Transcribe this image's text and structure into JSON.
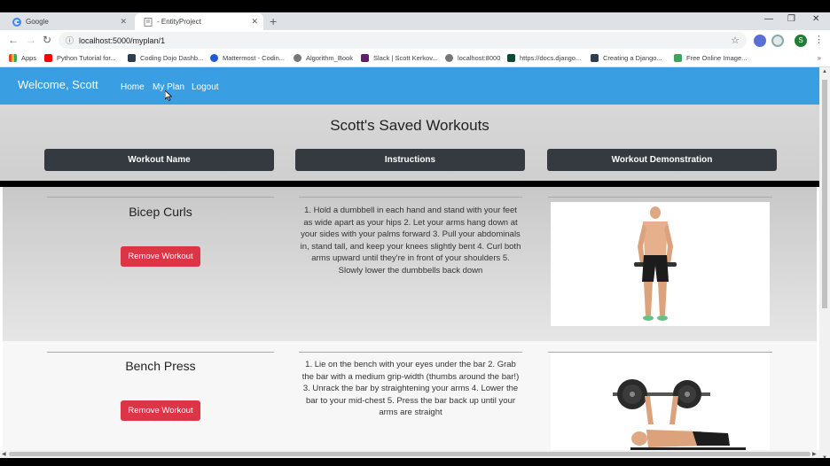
{
  "browser": {
    "tabs": [
      {
        "title": "Google",
        "active": false
      },
      {
        "title": "- EntityProject",
        "active": true
      }
    ],
    "url": "localhost:5000/myplan/1",
    "profile_initial": "S",
    "bookmarks": [
      {
        "label": "Apps",
        "icon": "apps-grid-icon"
      },
      {
        "label": "Python Tutorial for...",
        "icon": "youtube-icon"
      },
      {
        "label": "Coding Dojo Dashb...",
        "icon": "coding-dojo-icon"
      },
      {
        "label": "Mattermost - Codin...",
        "icon": "mattermost-icon"
      },
      {
        "label": "Algorithm_Book",
        "icon": "globe-icon"
      },
      {
        "label": "Slack | Scott Kerkov...",
        "icon": "slack-icon"
      },
      {
        "label": "localhost:8000",
        "icon": "globe-icon"
      },
      {
        "label": "https://docs.django...",
        "icon": "django-icon"
      },
      {
        "label": "Creating a Django...",
        "icon": "coding-dojo-icon"
      },
      {
        "label": "Free Online Image...",
        "icon": "image-icon"
      }
    ]
  },
  "nav": {
    "welcome": "Welcome, Scott",
    "links": [
      "Home",
      "My Plan",
      "Logout"
    ]
  },
  "page": {
    "title": "Scott's Saved Workouts",
    "columns": [
      "Workout Name",
      "Instructions",
      "Workout Demonstration"
    ]
  },
  "workouts": [
    {
      "name": "Bicep Curls",
      "remove_label": "Remove Workout",
      "instructions": "1. Hold a dumbbell in each hand and stand with your feet as wide apart as your hips 2. Let your arms hang down at your sides with your palms forward 3. Pull your abdominals in, stand tall, and keep your knees slightly bent 4. Curl both arms upward until they're in front of your shoulders 5. Slowly lower the dumbbells back down"
    },
    {
      "name": "Bench Press",
      "remove_label": "Remove Workout",
      "instructions": "1. Lie on the bench with your eyes under the bar 2. Grab the bar with a medium grip-width (thumbs around the bar!) 3. Unrack the bar by straightening your arms 4. Lower the bar to your mid-chest 5. Press the bar back up until your arms are straight"
    }
  ],
  "colors": {
    "navbar": "#3a9ee2",
    "column_header": "#343a40",
    "remove_button": "#dc3545"
  }
}
